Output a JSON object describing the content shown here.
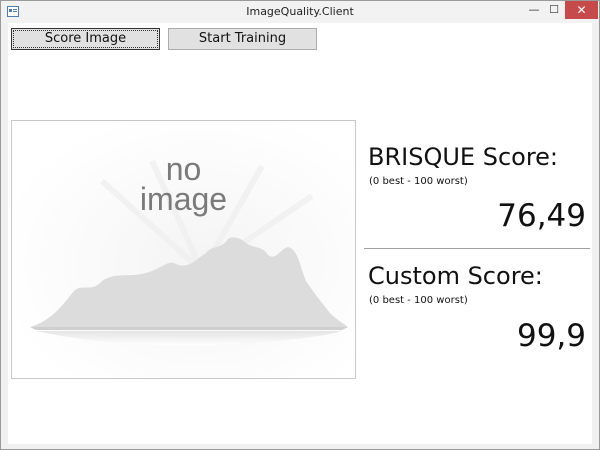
{
  "window": {
    "title": "ImageQuality.Client",
    "minimize_glyph": "—",
    "maximize_glyph": "☐",
    "close_glyph": "✕"
  },
  "toolbar": {
    "score_image_label": "Score Image",
    "start_training_label": "Start Training"
  },
  "preview": {
    "placeholder_line1": "no",
    "placeholder_line2": "image"
  },
  "brisque": {
    "title": "BRISQUE Score:",
    "range": "(0 best - 100 worst)",
    "value": "76,49"
  },
  "custom": {
    "title": "Custom Score:",
    "range": "(0 best - 100 worst)",
    "value": "99,9"
  },
  "colors": {
    "close_button": "#c74a4a",
    "button_face": "#e1e1e1",
    "placeholder_text": "#7a7a7a"
  }
}
